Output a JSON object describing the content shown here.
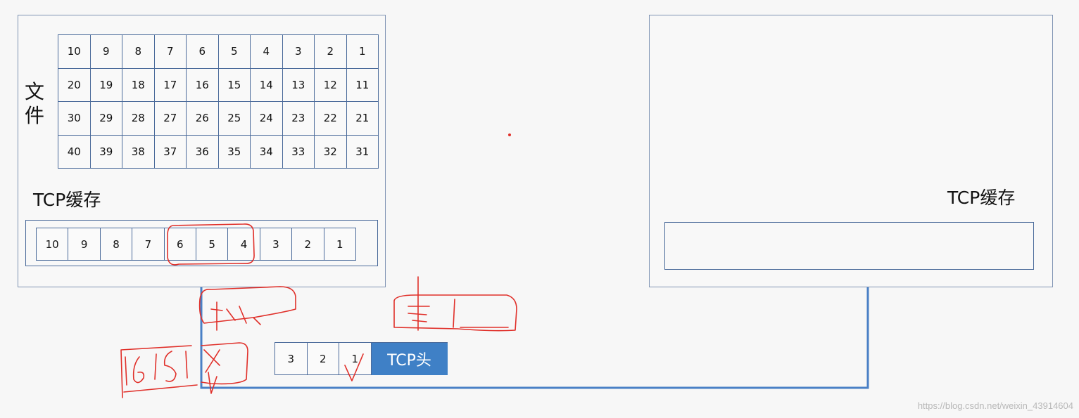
{
  "left": {
    "file_label": "文件",
    "cache_label": "TCP缓存",
    "file_grid": [
      [
        "10",
        "9",
        "8",
        "7",
        "6",
        "5",
        "4",
        "3",
        "2",
        "1"
      ],
      [
        "20",
        "19",
        "18",
        "17",
        "16",
        "15",
        "14",
        "13",
        "12",
        "11"
      ],
      [
        "30",
        "29",
        "28",
        "27",
        "26",
        "25",
        "24",
        "23",
        "22",
        "21"
      ],
      [
        "40",
        "39",
        "38",
        "37",
        "36",
        "35",
        "34",
        "33",
        "32",
        "31"
      ]
    ],
    "buffer": [
      "10",
      "9",
      "8",
      "7",
      "6",
      "5",
      "4",
      "3",
      "2",
      "1"
    ]
  },
  "right": {
    "cache_label": "TCP缓存"
  },
  "packet": {
    "cells": [
      "3",
      "2",
      "1"
    ],
    "header": "TCP头"
  },
  "colors": {
    "line": "#4a80c6",
    "header": "#3f80c6",
    "border": "#4a6a9a",
    "annotation": "#e0302a"
  },
  "watermark": "https://blog.csdn.net/weixin_43914604"
}
